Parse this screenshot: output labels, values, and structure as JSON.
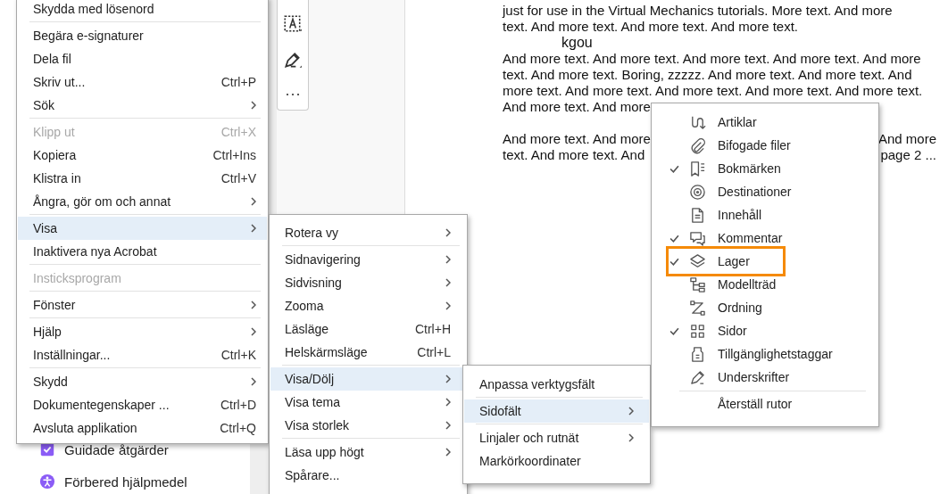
{
  "document": {
    "paragraphs": [
      {
        "lines": [
          {
            "left": "just for use in the Virtual Mechanics tutorials. More text. And more"
          },
          {
            "left": "text. And more text. And more text. And more text."
          }
        ]
      },
      {
        "lines": [
          {
            "left": "And more text. And more text. And more text. And more text. And more"
          },
          {
            "left": "text. And more text. Boring, zzzzz. And more text. And more text. And"
          },
          {
            "left": "more text. And more text. And more text. And more text. And more text."
          },
          {
            "left": "And more text. And more"
          }
        ]
      },
      {
        "lines": [
          {
            "left": "And more text. And more",
            "right": "And more"
          },
          {
            "left": "text. And more text. And",
            "right": "page 2 ..."
          }
        ]
      }
    ],
    "overlay_text": "kgou"
  },
  "tools": [
    {
      "label": "Guidade åtgärder"
    },
    {
      "label": "Förbered hjälpmedel"
    }
  ],
  "menus": [
    {
      "items": [
        {
          "kind": "item",
          "label": "Skydda med lösenord",
          "has_submenu": false,
          "disabled": false,
          "selected": false
        },
        {
          "kind": "separator"
        },
        {
          "kind": "item",
          "label": "Begära e-signaturer",
          "has_submenu": false,
          "disabled": false,
          "selected": false
        },
        {
          "kind": "item",
          "label": "Dela fil",
          "has_submenu": false,
          "disabled": false,
          "selected": false
        },
        {
          "kind": "item",
          "label": "Skriv ut...",
          "shortcut": "Ctrl+P",
          "has_submenu": false,
          "disabled": false,
          "selected": false
        },
        {
          "kind": "item",
          "label": "Sök",
          "has_submenu": true,
          "disabled": false,
          "selected": false
        },
        {
          "kind": "separator"
        },
        {
          "kind": "item",
          "label": "Klipp ut",
          "shortcut": "Ctrl+X",
          "has_submenu": false,
          "disabled": true,
          "selected": false
        },
        {
          "kind": "item",
          "label": "Kopiera",
          "shortcut": "Ctrl+Ins",
          "has_submenu": false,
          "disabled": false,
          "selected": false
        },
        {
          "kind": "item",
          "label": "Klistra in",
          "shortcut": "Ctrl+V",
          "has_submenu": false,
          "disabled": false,
          "selected": false
        },
        {
          "kind": "item",
          "label": "Ångra, gör om och annat",
          "has_submenu": true,
          "disabled": false,
          "selected": false
        },
        {
          "kind": "separator"
        },
        {
          "kind": "item",
          "label": "Visa",
          "has_submenu": true,
          "disabled": false,
          "selected": true
        },
        {
          "kind": "item",
          "label": "Inaktivera nya Acrobat",
          "has_submenu": false,
          "disabled": false,
          "selected": false
        },
        {
          "kind": "separator"
        },
        {
          "kind": "item",
          "label": "Insticksprogram",
          "has_submenu": false,
          "disabled": true,
          "selected": false
        },
        {
          "kind": "separator"
        },
        {
          "kind": "item",
          "label": "Fönster",
          "has_submenu": true,
          "disabled": false,
          "selected": false
        },
        {
          "kind": "separator"
        },
        {
          "kind": "item",
          "label": "Hjälp",
          "has_submenu": true,
          "disabled": false,
          "selected": false
        },
        {
          "kind": "item",
          "label": "Inställningar...",
          "shortcut": "Ctrl+K",
          "has_submenu": false,
          "disabled": false,
          "selected": false
        },
        {
          "kind": "separator"
        },
        {
          "kind": "item",
          "label": "Skydd",
          "has_submenu": true,
          "disabled": false,
          "selected": false
        },
        {
          "kind": "item",
          "label": "Dokumentegenskaper ...",
          "shortcut": "Ctrl+D",
          "has_submenu": false,
          "disabled": false,
          "selected": false
        },
        {
          "kind": "item",
          "label": "Avsluta applikation",
          "shortcut": "Ctrl+Q",
          "has_submenu": false,
          "disabled": false,
          "selected": false
        }
      ]
    },
    {
      "items": [
        {
          "kind": "item",
          "label": "Rotera vy",
          "has_submenu": true,
          "selected": false
        },
        {
          "kind": "separator"
        },
        {
          "kind": "item",
          "label": "Sidnavigering",
          "has_submenu": true,
          "selected": false
        },
        {
          "kind": "item",
          "label": "Sidvisning",
          "has_submenu": true,
          "selected": false
        },
        {
          "kind": "item",
          "label": "Zooma",
          "has_submenu": true,
          "selected": false
        },
        {
          "kind": "item",
          "label": "Läsläge",
          "shortcut": "Ctrl+H",
          "has_submenu": false,
          "selected": false
        },
        {
          "kind": "item",
          "label": "Helskärmsläge",
          "shortcut": "Ctrl+L",
          "has_submenu": false,
          "selected": false
        },
        {
          "kind": "separator"
        },
        {
          "kind": "item",
          "label": "Visa/Dölj",
          "has_submenu": true,
          "selected": true
        },
        {
          "kind": "item",
          "label": "Visa tema",
          "has_submenu": true,
          "selected": false
        },
        {
          "kind": "item",
          "label": "Visa storlek",
          "has_submenu": true,
          "selected": false
        },
        {
          "kind": "separator"
        },
        {
          "kind": "item",
          "label": "Läsa upp högt",
          "has_submenu": true,
          "selected": false
        },
        {
          "kind": "item",
          "label": "Spårare...",
          "has_submenu": false,
          "selected": false
        }
      ]
    },
    {
      "items": [
        {
          "kind": "item",
          "label": "Anpassa verktygsfält",
          "has_submenu": false,
          "selected": false
        },
        {
          "kind": "separator"
        },
        {
          "kind": "item",
          "label": "Sidofält",
          "has_submenu": true,
          "selected": true
        },
        {
          "kind": "separator"
        },
        {
          "kind": "item",
          "label": "Linjaler och rutnät",
          "has_submenu": true,
          "selected": false
        },
        {
          "kind": "item",
          "label": "Markörkoordinater",
          "has_submenu": false,
          "selected": false
        }
      ]
    }
  ],
  "sidebar_menu": {
    "items": [
      {
        "kind": "item",
        "label": "Artiklar",
        "checked": false,
        "boxed": false
      },
      {
        "kind": "item",
        "label": "Bifogade filer",
        "checked": false,
        "boxed": false
      },
      {
        "kind": "item",
        "label": "Bokmärken",
        "checked": true,
        "boxed": false
      },
      {
        "kind": "item",
        "label": "Destinationer",
        "checked": false,
        "boxed": false
      },
      {
        "kind": "item",
        "label": "Innehåll",
        "checked": false,
        "boxed": false
      },
      {
        "kind": "item",
        "label": "Kommentar",
        "checked": true,
        "boxed": false
      },
      {
        "kind": "item",
        "label": "Lager",
        "checked": true,
        "boxed": true
      },
      {
        "kind": "item",
        "label": "Modellträd",
        "checked": false,
        "boxed": false
      },
      {
        "kind": "item",
        "label": "Ordning",
        "checked": false,
        "boxed": false
      },
      {
        "kind": "item",
        "label": "Sidor",
        "checked": true,
        "boxed": false
      },
      {
        "kind": "item",
        "label": "Tillgänglighetstaggar",
        "checked": false,
        "boxed": false
      },
      {
        "kind": "item",
        "label": "Underskrifter",
        "checked": false,
        "boxed": false
      },
      {
        "kind": "separator"
      },
      {
        "kind": "item",
        "label": "Återställ rutor",
        "checked": false,
        "boxed": false
      }
    ]
  }
}
